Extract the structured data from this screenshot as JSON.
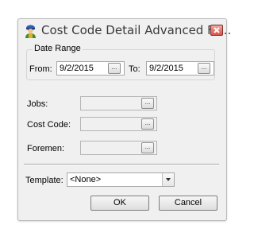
{
  "window": {
    "title": "Cost Code Detail Advanced Fil...",
    "app_icon": "person-helmet-icon",
    "close_icon": "close-x-icon"
  },
  "date_range": {
    "legend": "Date Range",
    "from_label": "From:",
    "from_value": "9/2/2015",
    "to_label": "To:",
    "to_value": "9/2/2015",
    "button_label": "..."
  },
  "filters": {
    "jobs_label": "Jobs:",
    "jobs_value": "",
    "cost_code_label": "Cost Code:",
    "cost_code_value": "",
    "foremen_label": "Foremen:",
    "foremen_value": "",
    "button_label": "..."
  },
  "template": {
    "label": "Template:",
    "selected": "<None>"
  },
  "buttons": {
    "ok": "OK",
    "cancel": "Cancel"
  },
  "colors": {
    "window_bg": "#f0f0f0",
    "close_button": "#d9534a",
    "title_text": "#3a3a3a"
  }
}
